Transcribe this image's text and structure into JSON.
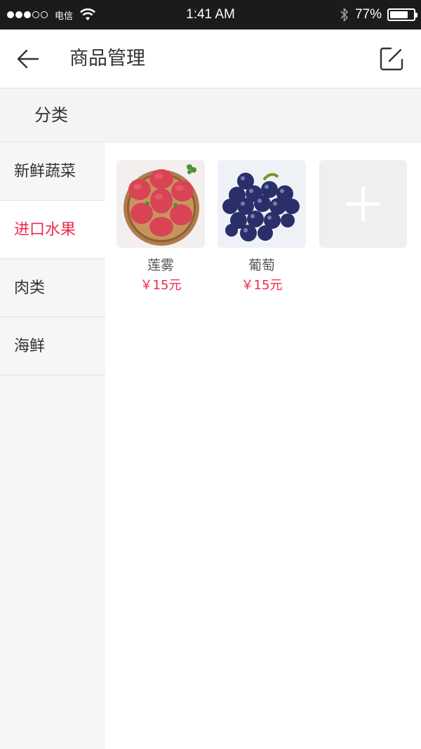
{
  "status_bar": {
    "carrier": "电信",
    "time": "1:41 AM",
    "battery_text": "77%",
    "battery_level": 0.77
  },
  "nav": {
    "title": "商品管理",
    "back_icon": "back-arrow-icon",
    "edit_icon": "edit-icon"
  },
  "section": {
    "title": "分类"
  },
  "categories": [
    {
      "label": "新鲜蔬菜",
      "active": false
    },
    {
      "label": "进口水果",
      "active": true
    },
    {
      "label": "肉类",
      "active": false
    },
    {
      "label": "海鲜",
      "active": false
    }
  ],
  "products": [
    {
      "name": "莲雾",
      "price": "￥15元",
      "image": "wax-apple-image"
    },
    {
      "name": "葡萄",
      "price": "￥15元",
      "image": "grapes-image"
    }
  ],
  "add_button": {
    "icon": "plus-icon"
  },
  "colors": {
    "accent": "#ee2b4c",
    "status_bar_bg": "#1b1b1b",
    "sidebar_bg": "#f6f6f6"
  }
}
